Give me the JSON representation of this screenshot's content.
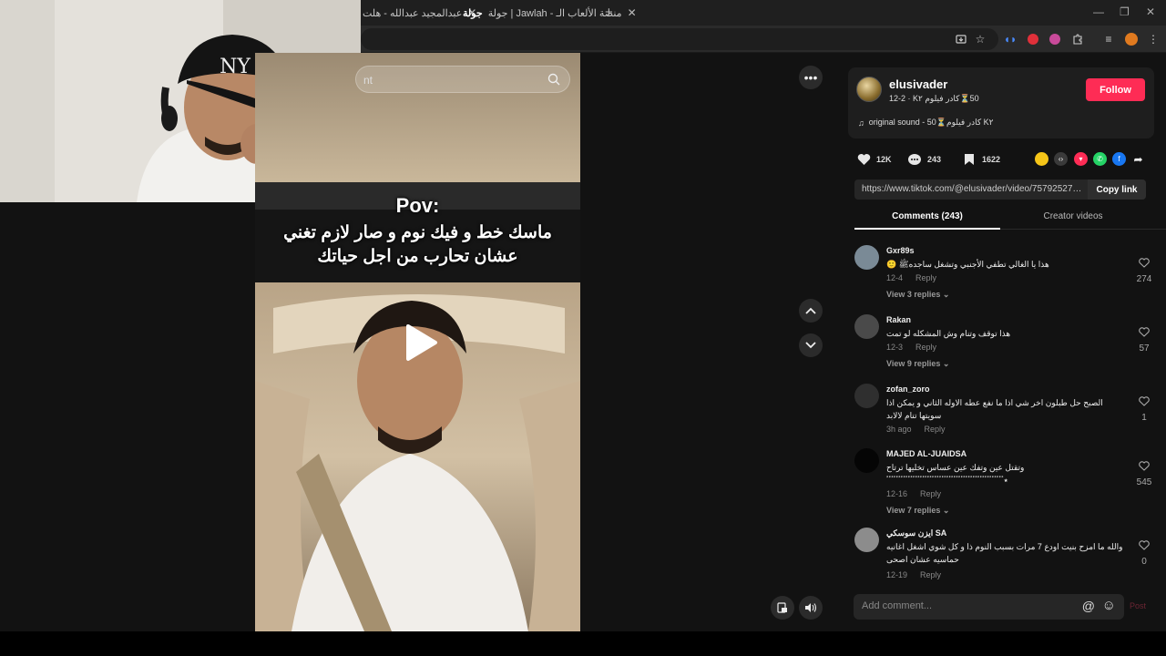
{
  "browser": {
    "tabs": [
      {
        "label": "عبدالمجيد عبدالله - هلت"
      },
      {
        "label": "جولة | Jawlah - منصة الألعاب الـ"
      }
    ],
    "tab_brand": "جولة",
    "new_tab": "+"
  },
  "video": {
    "search_placeholder": "nt",
    "pov_title": "Pov:",
    "caption_lines": [
      "ماسك خط و فيك نوم و صار لازم تغني",
      "عشان تحارب من اجل حياتك"
    ]
  },
  "author": {
    "name": "elusivader",
    "subtitle": "50⏳كادر فيلوم K٢ · 12-2",
    "follow_label": "Follow",
    "sound": "original sound - 50⏳كادر فيلوم K٢"
  },
  "stats": {
    "likes": "12K",
    "comments": "243",
    "saves": "1622"
  },
  "share": {
    "colors": [
      "#f5c518",
      "#3a3a3a",
      "#fe2c55",
      "#25d366",
      "#1877f2"
    ]
  },
  "link": {
    "url": "https://www.tiktok.com/@elusivader/video/757925279...",
    "copy_label": "Copy link"
  },
  "tabs": {
    "comments": "Comments (243)",
    "creator": "Creator videos"
  },
  "comments": [
    {
      "user": "Gxr89s",
      "text": "هذا يا الغالي تطفي الأجنبي وتشغل ساجدهﷺ 🙂",
      "date": "12-4",
      "reply": "Reply",
      "replies": "View 3 replies",
      "likes": "274",
      "avatar_color": "#7a8a96"
    },
    {
      "user": "Rakan",
      "text": "هذا توقف وتنام وش المشكله لو تمت",
      "date": "12-3",
      "reply": "Reply",
      "replies": "View 9 replies",
      "likes": "57",
      "avatar_color": "#4a4a4a"
    },
    {
      "user": "zofan_zoro",
      "text": "الصبح حل طبلون اخر شي اذا ما نفع عطه الاوله الثاني و يمكن اذا سويتها تنام لالابد",
      "date": "3h ago",
      "reply": "Reply",
      "replies": "",
      "likes": "1",
      "avatar_color": "#2f2f2f"
    },
    {
      "user": "MAJED AL-JUAIDSA",
      "text": "وتقتل عين وتفك عين عساس تخليها ترتاح ٭ٴٴٴٴٴٴٴٴٴٴٴٴٴٴٴٴٴٴٴٴٴٴٴٴٴٴٴٴٴٴٴٴٴٴٴٴٴٴٴٴٴٴٴٴٴٴٴٴٴ",
      "date": "12-16",
      "reply": "Reply",
      "replies": "View 7 replies",
      "likes": "545",
      "avatar_color": "#050505"
    },
    {
      "user": "ايزن سوسكي SA",
      "text": "والله ما امزح بنيت اودع 7 مرات بسبب النوم ذا و كل شوي اشغل اغانيه حماسيه عشان اصحى",
      "date": "12-19",
      "reply": "Reply",
      "replies": "",
      "likes": "0",
      "avatar_color": "#8c8c8c"
    }
  ],
  "input": {
    "placeholder": "Add comment...",
    "post_label": "Post"
  }
}
